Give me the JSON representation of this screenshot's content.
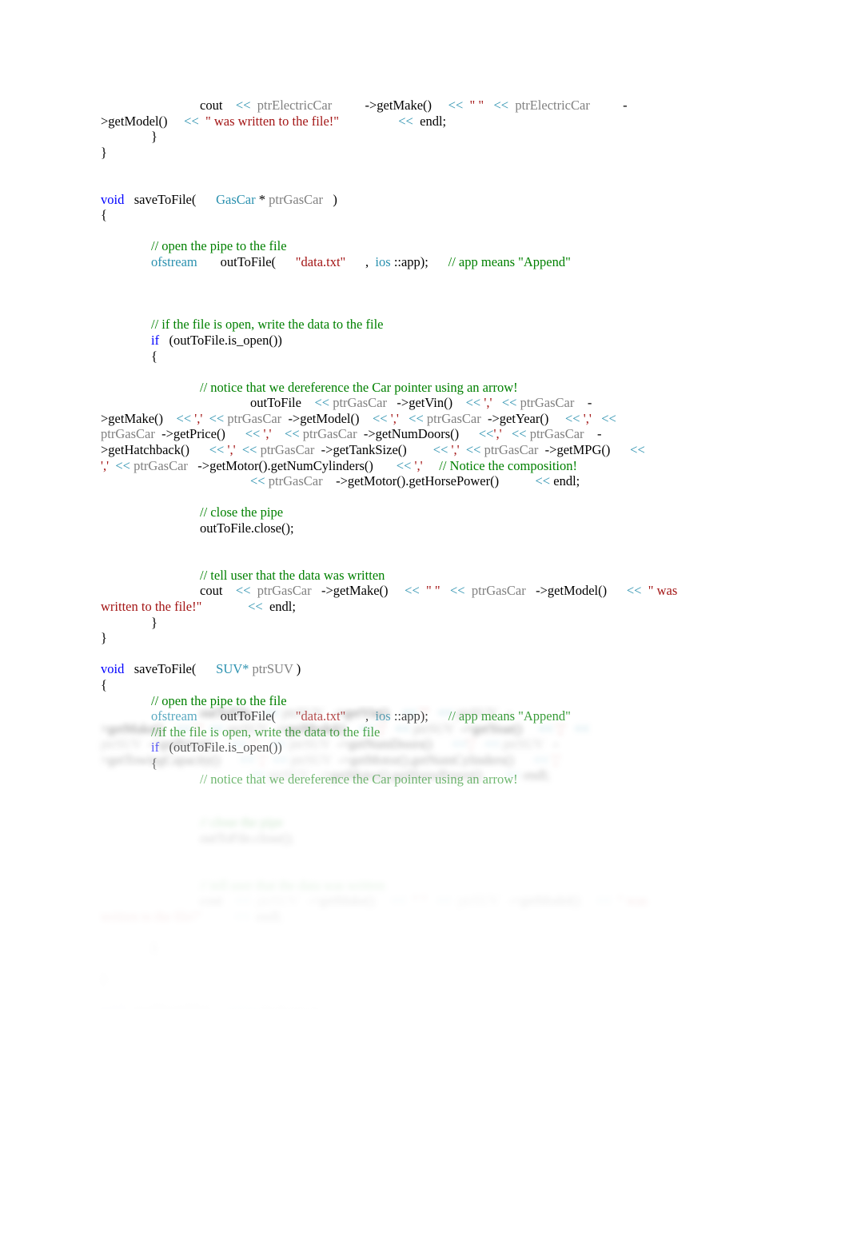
{
  "document": {
    "kind": "cpp-source-listing",
    "page_background": "#ffffff"
  },
  "colors": {
    "keyword": "#0000ff",
    "type": "#2b91af",
    "identifier": "#808080",
    "string": "#a31515",
    "comment": "#008000",
    "operator": "#2b91af",
    "plain": "#000000"
  },
  "code": {
    "electric_car_tail": {
      "l1_a": "cout",
      "l1_op1": "<<",
      "l1_ptr1": "ptrElectricCar",
      "l1_call1": "->getMake()",
      "l1_op2": "<<",
      "l1_str1": "\" \"",
      "l1_op3": "<<",
      "l1_ptr2": "ptrElectricCar",
      "l1_dash": "-",
      "l2_call": ">getModel()",
      "l2_op1": "<<",
      "l2_str": "\" was written to the file!\"",
      "l2_op2": "<<",
      "l2_endl": "endl;",
      "l3_brace": "}",
      "l4_brace": "}"
    },
    "gascar_fn": {
      "sig_kw": "void",
      "sig_name": "saveToFile(",
      "sig_type": "GasCar",
      "sig_star": "*",
      "sig_param": "ptrGasCar",
      "sig_close": ")",
      "open_brace": "{",
      "cmt_open_pipe": "// open the pipe to the file",
      "ofstream_type": "ofstream",
      "ofstream_name": "outToFile(",
      "ofstream_file": "\"data.txt\"",
      "ofstream_comma": ",",
      "ofstream_ios": "ios",
      "ofstream_app": "::app);",
      "cmt_append": "// app means \"Append\"",
      "cmt_if_open": "// if the file is open, write the data to the file",
      "if_kw": "if",
      "if_cond": "(outToFile.is_open())",
      "if_brace": "{",
      "cmt_deref": "// notice that we dereference the Car pointer using an arrow!",
      "w1_stream": "outToFile",
      "w1_op1": "<<",
      "w1_ptr1": "ptrGasCar",
      "w1_call1": "->getVin()",
      "w1_op2": "<<",
      "w1_char1": "','",
      "w1_op3": "<<",
      "w1_ptr2": "ptrGasCar",
      "w1_dash": "-",
      "w2_call": ">getMake()",
      "w2_op1": "<<",
      "w2_char1": "','",
      "w2_op2": "<<",
      "w2_ptr1": "ptrGasCar",
      "w2_call2": "->getModel()",
      "w2_op3": "<<",
      "w2_char2": "','",
      "w2_op4": "<<",
      "w2_ptr2": "ptrGasCar",
      "w2_call3": "->getYear()",
      "w2_op5": "<<",
      "w2_char3": "','",
      "w2_op6": "<<",
      "w3_ptr1": "ptrGasCar",
      "w3_call1": "->getPrice()",
      "w3_op1": "<<",
      "w3_char1": "','",
      "w3_op2": "<<",
      "w3_ptr2": "ptrGasCar",
      "w3_call2": "->getNumDoors()",
      "w3_op3": "<<",
      "w3_char2": "','",
      "w3_op4": "<<",
      "w3_ptr3": "ptrGasCar",
      "w3_dash": "-",
      "w4_call": ">getHatchback()",
      "w4_op1": "<<",
      "w4_char1": "','",
      "w4_op2": "<<",
      "w4_ptr1": "ptrGasCar",
      "w4_call2": "->getTankSize()",
      "w4_op3": "<<",
      "w4_char2": "','",
      "w4_op4": "<<",
      "w4_ptr2": "ptrGasCar",
      "w4_call3": "->getMPG()",
      "w4_op5": "<<",
      "w5_char1": "','",
      "w5_op1": "<<",
      "w5_ptr1": "ptrGasCar",
      "w5_call1": "->getMotor().getNumCylinders()",
      "w5_op2": "<<",
      "w5_char2": "','",
      "w5_cmt": "// Notice the composition!",
      "w6_op1": "<<",
      "w6_ptr1": "ptrGasCar",
      "w6_call1": "->getMotor().getHorsePower()",
      "w6_op2": "<<",
      "w6_endl": "endl;",
      "cmt_close_pipe": "// close the pipe",
      "close_stmt": "outToFile.close();",
      "cmt_tell_user": "// tell user that the data was written",
      "t1_cout": "cout",
      "t1_op1": "<<",
      "t1_ptr1": "ptrGasCar",
      "t1_call1": "->getMake()",
      "t1_op2": "<<",
      "t1_str1": "\" \"",
      "t1_op3": "<<",
      "t1_ptr2": "ptrGasCar",
      "t1_call2": "->getModel()",
      "t1_op4": "<<",
      "t1_str2": "\" was",
      "t2_str": "written to the file!\"",
      "t2_op": "<<",
      "t2_endl": "endl;",
      "inner_close": "}",
      "outer_close": "}"
    },
    "suv_fn": {
      "sig_kw": "void",
      "sig_name": "saveToFile(",
      "sig_type": "SUV*",
      "sig_param": "ptrSUV",
      "sig_close": ")",
      "open_brace": "{",
      "cmt_open_pipe": "// open the pipe to the file",
      "ofstream_type": "ofstream",
      "ofstream_name": "outToFile(",
      "ofstream_file": "\"data.txt\"",
      "ofstream_comma": ",",
      "ofstream_ios": "ios",
      "ofstream_app": "::app);",
      "cmt_append": "// app means \"Append\"",
      "cmt_if_open": "//if the file is open, write the data to the file",
      "if_kw": "if",
      "if_cond": "(outToFile.is_open())",
      "if_brace": "{",
      "cmt_deref": "// notice that we dereference the Car pointer using an arrow!"
    },
    "faded_tail": {
      "f1_stream": "outToFile",
      "f1_op1": "<<",
      "f1_ptr1": "ptrSUV",
      "f1_call1": "->getVin()",
      "f1_op2": "<<",
      "f1_char1": "','",
      "f1_op3": "<<",
      "f1_ptr2": "ptrSUV",
      "f1_dash": "-",
      "f2_call": ">getMake()",
      "f2_op1": "<<",
      "f2_char1": "','",
      "f2_op2": "<<",
      "f2_ptr1": "ptrSUV",
      "f2_call2": "->getModel()",
      "f2_op3": "<<",
      "f2_char2": "','",
      "f2_op4": "<<",
      "f2_ptr2": "ptrSUV",
      "f2_call3": "->getYear()",
      "f2_op5": "<<",
      "f2_char3": "','",
      "f2_op6": "<<",
      "f3_ptr1": "ptrSUV",
      "f3_call1": "->getPrice()",
      "f3_op1": "<<",
      "f3_char1": "','",
      "f3_op2": "<<",
      "f3_ptr2": "ptrSUV",
      "f3_call2": "->getNumDoors()",
      "f3_op3": "<<",
      "f3_char2": "','",
      "f3_op4": "<<",
      "f3_ptr3": "ptrSUV",
      "f3_dash": "-",
      "f4_call": ">getTowingCapacity()",
      "f4_op1": "<<",
      "f4_char1": "','",
      "f4_op2": "<<",
      "f4_ptr1": "ptrSUV",
      "f4_call2": "->getMotor().getNumCylinders()",
      "f4_op3": "<<",
      "f4_char2": "','",
      "f5_op1": "<<",
      "f5_ptr1": "ptrSUV",
      "f5_call1": "->getMotor().getHorsePower()",
      "f5_op2": "<<",
      "f5_endl": "endl;",
      "f6_cmt": "// close the pipe",
      "f6_stmt": "outToFile.close();",
      "f7_cmt": "// tell user that the data was written",
      "f8_cout": "cout",
      "f8_op1": "<<",
      "f8_ptr1": "ptrSUV",
      "f8_call1": "->getMake()",
      "f8_op2": "<<",
      "f8_str1": "\" \"",
      "f8_op3": "<<",
      "f8_ptr2": "ptrSUV",
      "f8_call2": "->getModel()",
      "f8_op4": "<<",
      "f8_str2": "\" was",
      "f9_str": "written to the file!\"",
      "f9_op": "<<",
      "f9_endl": "endl;",
      "f10_brace": "}",
      "f11_brace": "}",
      "f12_kw": "void",
      "f12_name": "readFromFile(",
      "f12_type": "string",
      "f12_param": "fileName",
      "f12_close": ")"
    }
  }
}
